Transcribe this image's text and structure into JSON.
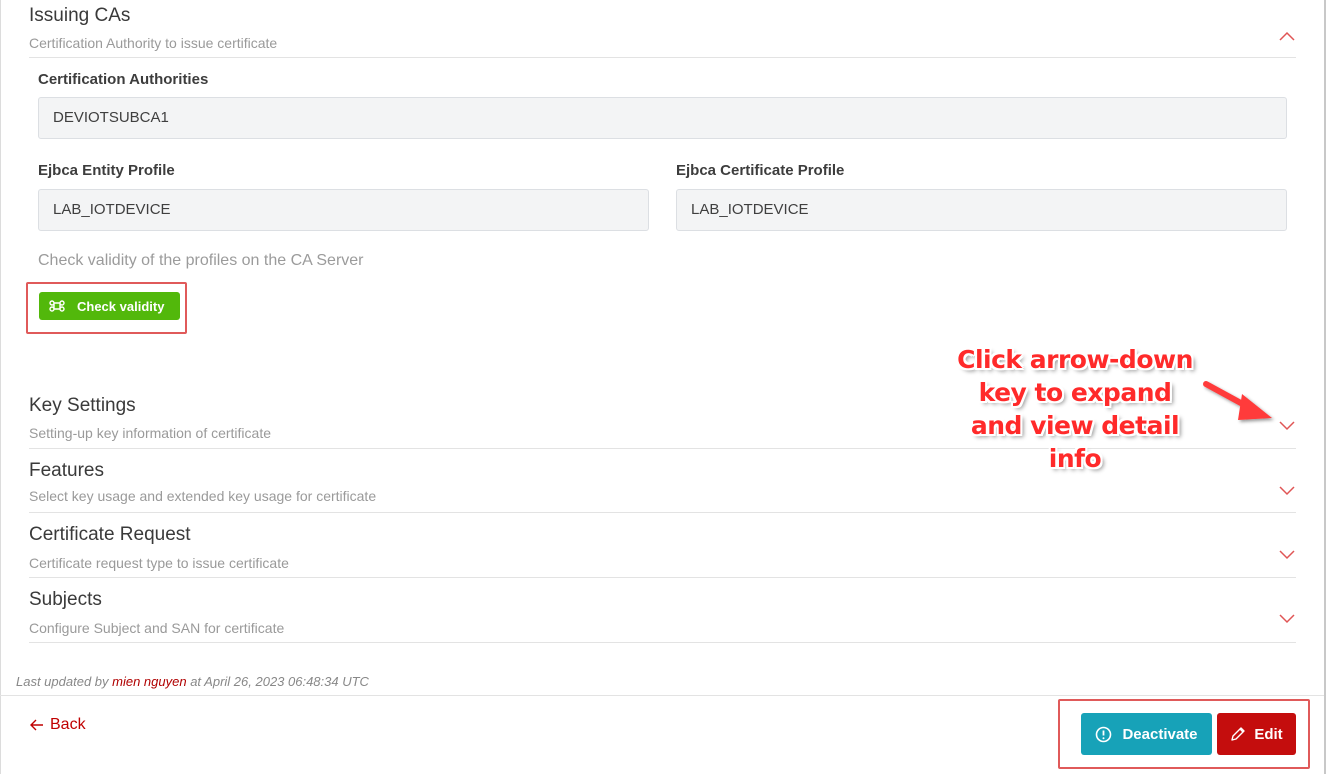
{
  "issuing": {
    "title": "Issuing CAs",
    "subtitle": "Certification Authority to issue certificate",
    "ca_label": "Certification Authorities",
    "ca_value": "DEVIOTSUBCA1",
    "entity_label": "Ejbca Entity Profile",
    "entity_value": "LAB_IOTDEVICE",
    "cert_profile_label": "Ejbca Certificate Profile",
    "cert_profile_value": "LAB_IOTDEVICE",
    "hint": "Check validity of the profiles on the CA Server",
    "check_button": "Check validity"
  },
  "sections": [
    {
      "title": "Key Settings",
      "subtitle": "Setting-up key information of certificate"
    },
    {
      "title": "Features",
      "subtitle": "Select key usage and extended key usage for certificate"
    },
    {
      "title": "Certificate Request",
      "subtitle": "Certificate request type to issue certificate"
    },
    {
      "title": "Subjects",
      "subtitle": "Configure Subject and SAN for certificate"
    }
  ],
  "annotation": {
    "lines": [
      "Click arrow-down",
      "key to expand",
      "and view detail",
      "info"
    ]
  },
  "footer": {
    "prefix": "Last updated by ",
    "user": "mien nguyen",
    "suffix": " at April 26, 2023 06:48:34 UTC",
    "back": "Back",
    "deactivate": "Deactivate",
    "edit": "Edit"
  },
  "colors": {
    "accent_red": "#c40d0d",
    "check_green": "#52b80b",
    "deactivate_teal": "#17a2b8",
    "annotation_red": "#ff2a2a"
  },
  "icons": {
    "check_button": "command-icon",
    "deactivate": "exclamation-circle-icon",
    "edit": "pencil-icon",
    "back": "arrow-left-icon",
    "expanded": "chevron-up-icon",
    "collapsed": "chevron-down-icon"
  }
}
